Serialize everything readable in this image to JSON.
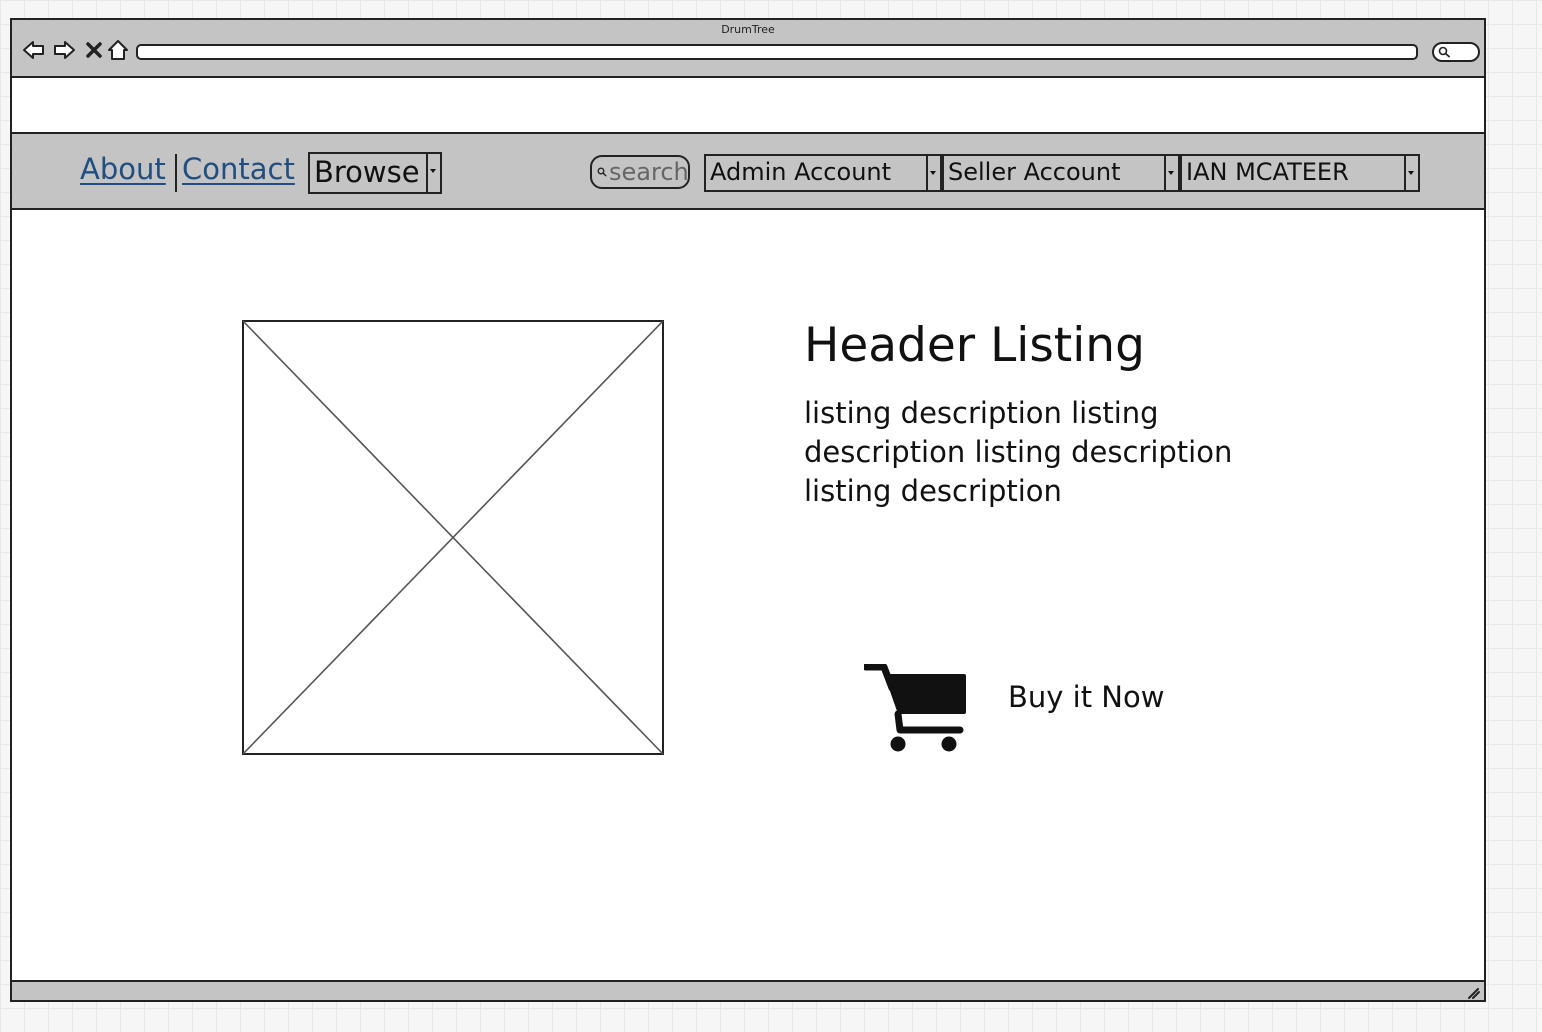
{
  "window": {
    "title": "DrumTree"
  },
  "navbar": {
    "links": [
      {
        "label": "About"
      },
      {
        "label": "Contact"
      }
    ],
    "browse": {
      "label": "Browse"
    },
    "search": {
      "placeholder": "search"
    },
    "account_selects": [
      {
        "label": "Admin Account"
      },
      {
        "label": "Seller Account"
      },
      {
        "label": "IAN MCATEER"
      }
    ]
  },
  "listing": {
    "title": "Header Listing",
    "description": "listing description listing description listing description listing description"
  },
  "purchase": {
    "icon": "shopping-cart-icon",
    "label": "Buy it Now"
  },
  "colors": {
    "chrome": "#c4c4c4",
    "link": "#1f4f82",
    "ink": "#222222"
  }
}
